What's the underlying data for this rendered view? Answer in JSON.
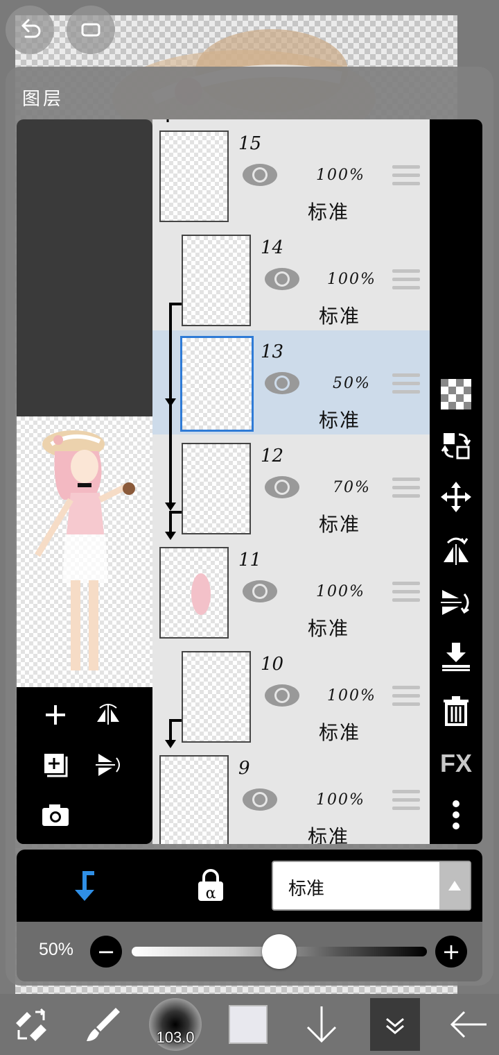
{
  "panel": {
    "title": "图层"
  },
  "layers": [
    {
      "number": "15",
      "opacity": "100%",
      "blend": "标准",
      "clipped": false,
      "selected": false
    },
    {
      "number": "14",
      "opacity": "100%",
      "blend": "标准",
      "clipped": true,
      "selected": false
    },
    {
      "number": "13",
      "opacity": "50%",
      "blend": "标准",
      "clipped": true,
      "selected": true
    },
    {
      "number": "12",
      "opacity": "70%",
      "blend": "标准",
      "clipped": true,
      "selected": false
    },
    {
      "number": "11",
      "opacity": "100%",
      "blend": "标准",
      "clipped": false,
      "selected": false
    },
    {
      "number": "10",
      "opacity": "100%",
      "blend": "标准",
      "clipped": true,
      "selected": false
    },
    {
      "number": "9",
      "opacity": "100%",
      "blend": "标准",
      "clipped": false,
      "selected": false
    }
  ],
  "right_toolbar": {
    "fx_label": "FX"
  },
  "blend_bar": {
    "mode_value": "标准"
  },
  "opacity_bar": {
    "value_label": "50%",
    "value": 0.5,
    "minus": "−",
    "plus": "+"
  },
  "bottom_toolbar": {
    "brush_size": "103.0"
  },
  "colors": {
    "selected_row": "#cddbea",
    "accent_blue": "#2f8fe6",
    "selection_border": "#2f7bd6"
  }
}
